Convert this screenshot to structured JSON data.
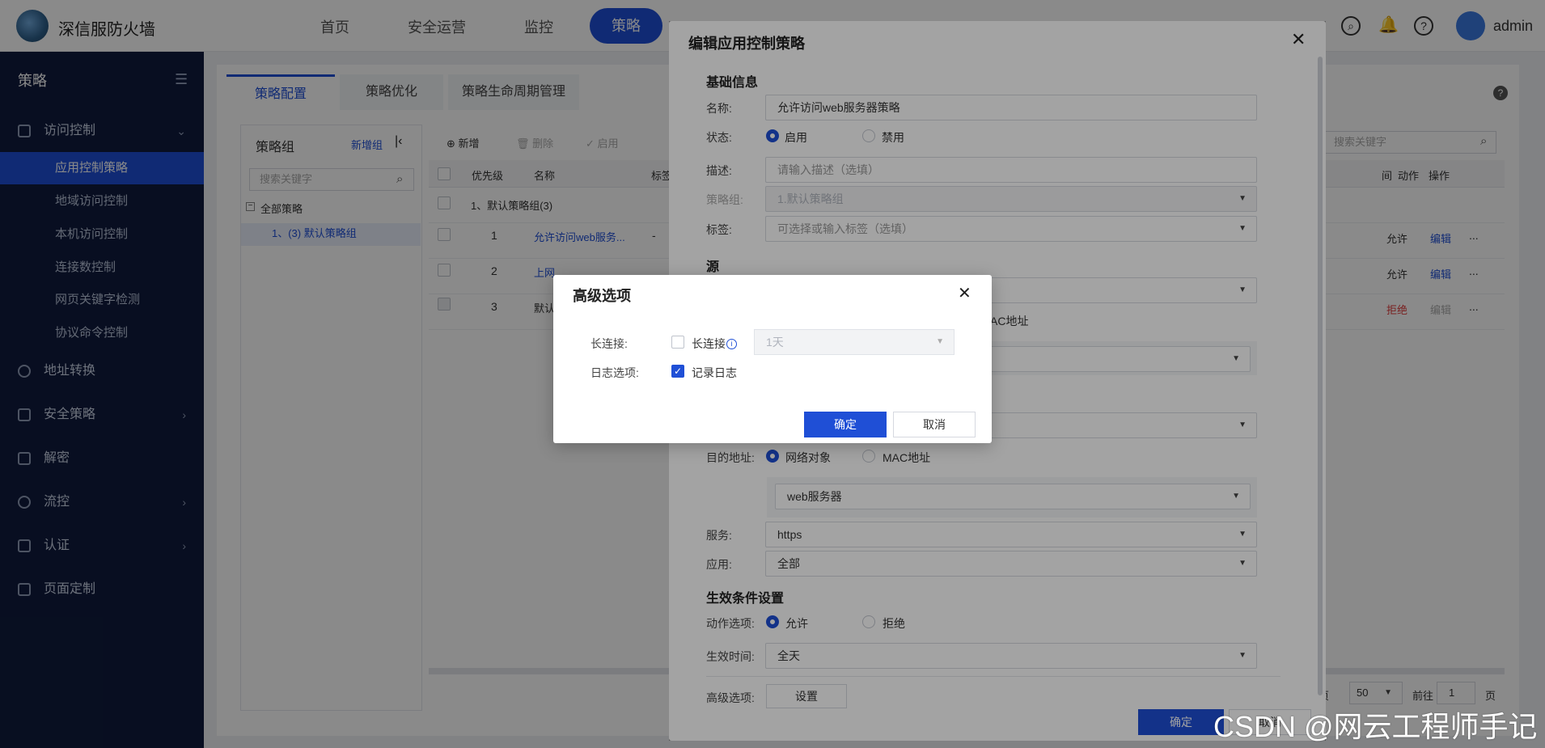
{
  "app": {
    "brand": "深信服防火墙",
    "user": "admin"
  },
  "topnav": {
    "items": [
      "首页",
      "安全运营",
      "监控",
      "策略"
    ],
    "active": "策略"
  },
  "sidebar": {
    "title": "策略",
    "group": "访问控制",
    "subitems": [
      "应用控制策略",
      "地域访问控制",
      "本机访问控制",
      "连接数控制",
      "网页关键字检测",
      "协议命令控制"
    ],
    "items": [
      "地址转换",
      "安全策略",
      "解密",
      "流控",
      "认证",
      "页面定制"
    ]
  },
  "tabs": [
    "策略配置",
    "策略优化",
    "策略生命周期管理"
  ],
  "group_panel": {
    "title": "策略组",
    "new_group": "新增组",
    "search_placeholder": "搜索关键字",
    "tree_root": "全部策略",
    "tree_child": "1、(3) 默认策略组"
  },
  "toolbar": {
    "add": "新增",
    "delete": "删除",
    "enable": "启用",
    "search_placeholder": "搜索关键字"
  },
  "table": {
    "headers": {
      "priority": "优先级",
      "name": "名称",
      "tag": "标签",
      "time": "间",
      "action": "动作",
      "ops": "操作"
    },
    "group_row": "1、默认策略组(3)",
    "rows": [
      {
        "priority": "1",
        "name": "允许访问web服务...",
        "tag": "-",
        "action": "允许",
        "edit": "编辑",
        "more": "..."
      },
      {
        "priority": "2",
        "name": "上网",
        "tag": "",
        "action": "允许",
        "edit": "编辑",
        "more": "..."
      },
      {
        "priority": "3",
        "name": "默认",
        "tag": "",
        "action": "拒绝",
        "edit": "编辑",
        "more": "..."
      }
    ],
    "pager": {
      "per_page_suffix": "页",
      "per_page": "50",
      "goto": "前往",
      "page": "1",
      "page_suffix": "页"
    }
  },
  "edit_modal": {
    "title": "编辑应用控制策略",
    "basic": "基础信息",
    "name_label": "名称:",
    "name_value": "允许访问web服务器策略",
    "status_label": "状态:",
    "status_on": "启用",
    "status_off": "禁用",
    "desc_label": "描述:",
    "desc_placeholder": "请输入描述（选填）",
    "group_label": "策略组:",
    "group_value": "1.默认策略组",
    "tag_label": "标签:",
    "tag_placeholder": "可选择或输入标签（选填）",
    "source": "源",
    "mac_partial": "AC地址",
    "dest_label": "目的地址:",
    "dest_opt1": "网络对象",
    "dest_opt2": "MAC地址",
    "dest_value": "web服务器",
    "service_label": "服务:",
    "service_value": "https",
    "app_label": "应用:",
    "app_value": "全部",
    "effect": "生效条件设置",
    "action_label": "动作选项:",
    "action_allow": "允许",
    "action_deny": "拒绝",
    "time_label": "生效时间:",
    "time_value": "全天",
    "adv_label": "高级选项:",
    "adv_button": "设置",
    "ok": "确定",
    "cancel": "取消"
  },
  "adv_modal": {
    "title": "高级选项",
    "long_label": "长连接:",
    "long_checkbox": "长连接",
    "long_value": "1天",
    "log_label": "日志选项:",
    "log_checkbox": "记录日志",
    "ok": "确定",
    "cancel": "取消"
  },
  "watermark": "CSDN @网云工程师手记",
  "colors": {
    "primary": "#1f4fd6",
    "sidebar": "#0f1b3d",
    "deny": "#e03b3b"
  }
}
